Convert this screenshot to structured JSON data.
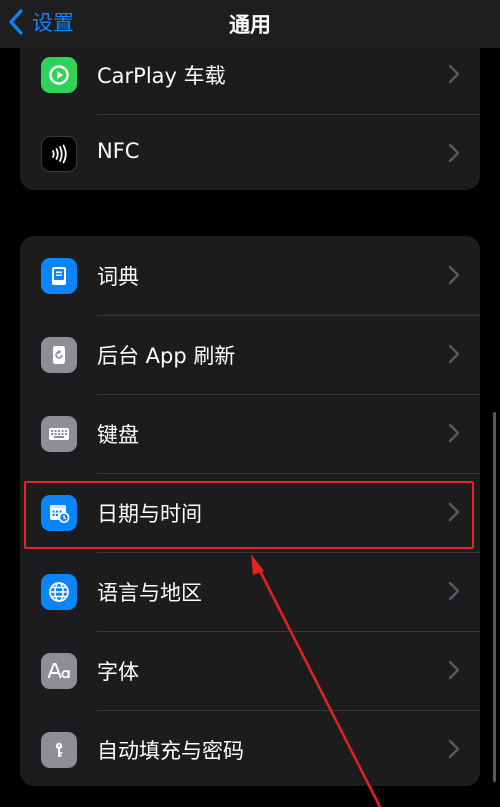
{
  "navbar": {
    "back_label": "设置",
    "title": "通用"
  },
  "group1": [
    {
      "label": "CarPlay 车载",
      "icon": "carplay-icon",
      "color": "#30d158"
    },
    {
      "label": "NFC",
      "icon": "nfc-icon",
      "color": "#000000"
    }
  ],
  "group2": [
    {
      "label": "词典",
      "icon": "dictionary-icon",
      "color": "#0a84ff"
    },
    {
      "label": "后台 App 刷新",
      "icon": "background-refresh-icon",
      "color": "#8e8e93"
    },
    {
      "label": "键盘",
      "icon": "keyboard-icon",
      "color": "#8e8e93"
    },
    {
      "label": "日期与时间",
      "icon": "date-time-icon",
      "color": "#0a84ff"
    },
    {
      "label": "语言与地区",
      "icon": "globe-icon",
      "color": "#0a84ff"
    },
    {
      "label": "字体",
      "icon": "fonts-icon",
      "color": "#8e8e93"
    },
    {
      "label": "自动填充与密码",
      "icon": "autofill-key-icon",
      "color": "#8e8e93"
    }
  ],
  "annotation": {
    "color": "#e3231f"
  }
}
